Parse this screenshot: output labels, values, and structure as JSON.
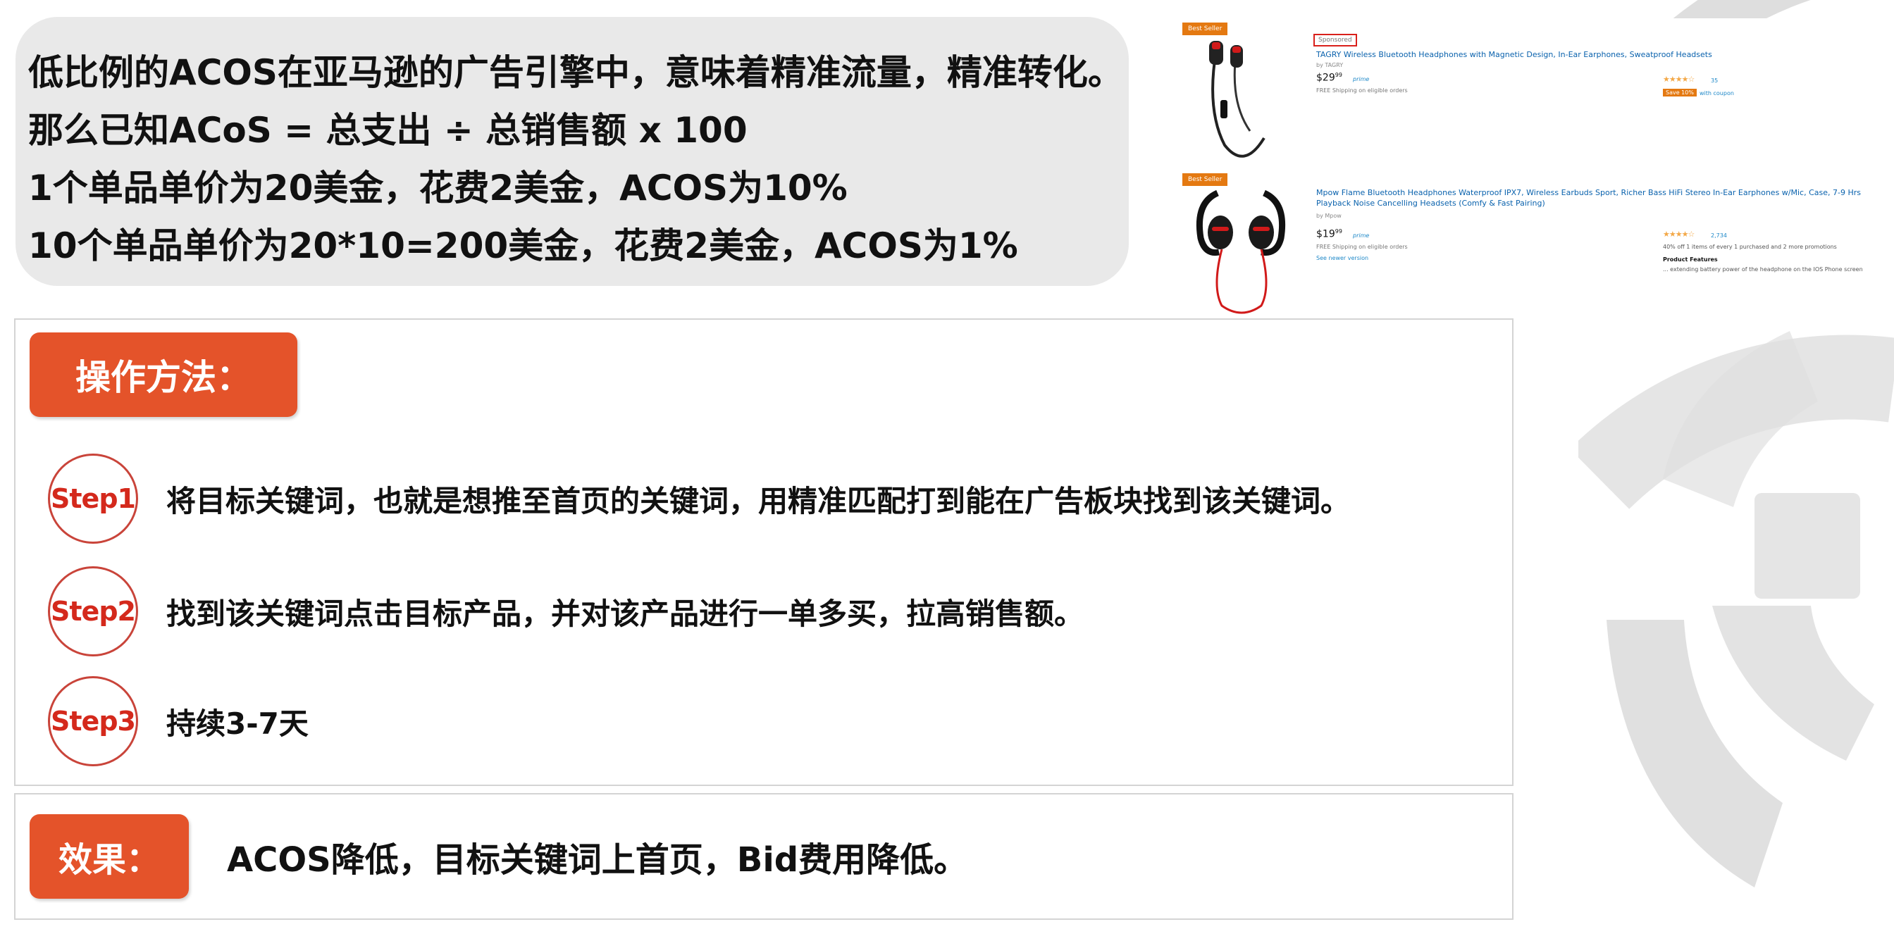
{
  "intro": {
    "lines": [
      "低比例的ACOS在亚马逊的广告引擎中，意味着精准流量，精准转化。",
      "那么已知ACoS = 总支出 ÷ 总销售额 x 100",
      "1个单品单价为20美金，花费2美金，ACOS为10%",
      "10个单品单价为20*10=200美金，花费2美金，ACOS为1%"
    ]
  },
  "listings": [
    {
      "badge": "Best Seller",
      "sponsored": "Sponsored",
      "title": "TAGRY Wireless Bluetooth Headphones with Magnetic Design, In-Ear Earphones, Sweatproof Headsets",
      "brand": "by TAGRY",
      "price": "$29",
      "cents": "99",
      "prime": "prime",
      "shipping": "FREE Shipping on eligible orders",
      "stars": "★★★★☆",
      "rating_count": "35",
      "save": "Save 10%",
      "coupon": "with coupon"
    },
    {
      "badge": "Best Seller",
      "title": "Mpow Flame Bluetooth Headphones Waterproof IPX7, Wireless Earbuds Sport, Richer Bass HiFi Stereo In-Ear Earphones w/Mic, Case, 7-9 Hrs Playback Noise Cancelling Headsets (Comfy & Fast Pairing)",
      "brand": "by Mpow",
      "price": "$19",
      "cents": "99",
      "prime": "prime",
      "shipping": "FREE Shipping on eligible orders",
      "more": "See newer version",
      "stars": "★★★★☆",
      "rating_count": "2,734",
      "promo": "40% off 1 items of every 1 purchased and 2 more promotions",
      "features_title": "Product Features",
      "features_text": "... extending battery power of the headphone on the IOS Phone screen"
    }
  ],
  "method": {
    "label": "操作方法：",
    "steps": [
      {
        "badge": "Step1",
        "text": "将目标关键词，也就是想推至首页的关键词，用精准匹配打到能在广告板块找到该关键词。"
      },
      {
        "badge": "Step2",
        "text": "找到该关键词点击目标产品，并对该产品进行一单多买，拉高销售额。"
      },
      {
        "badge": "Step3",
        "text": "持续3-7天"
      }
    ]
  },
  "effect": {
    "label": "效果：",
    "text": "ACOS降低，目标关键词上首页，Bid费用降低。"
  },
  "colors": {
    "accent": "#e4532a",
    "step_ring": "#c9443a",
    "intro_bg": "#e9e9e9"
  },
  "icons": {
    "watermark": "logo-watermark-icon",
    "product_1": "earphones-icon",
    "product_2": "sport-earphones-icon"
  }
}
